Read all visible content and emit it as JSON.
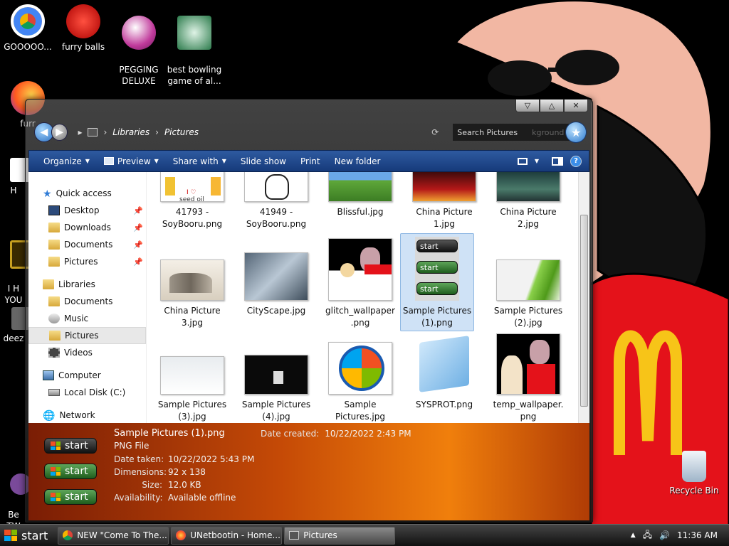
{
  "desktop": {
    "icons": [
      {
        "label": "GOOOOO..."
      },
      {
        "label": "furry balls"
      },
      {
        "label": "PEGGING\nDELUXE"
      },
      {
        "label": "best bowling\ngame of al..."
      },
      {
        "label": "furr"
      },
      {
        "label": "H"
      },
      {
        "label": "I H\nYOU"
      },
      {
        "label": "deez"
      },
      {
        "label": "Be\nTW"
      },
      {
        "label": "Recycle Bin"
      }
    ]
  },
  "window": {
    "caption_buttons": [
      "▽",
      "△",
      "✕"
    ],
    "breadcrumb": [
      "Libraries",
      "Pictures"
    ],
    "search_placeholder": "Search Pictures",
    "search_behind_text": "kground"
  },
  "toolbar": {
    "organize": "Organize",
    "preview": "Preview",
    "share_with": "Share with",
    "slide_show": "Slide show",
    "print": "Print",
    "new_folder": "New folder",
    "help": "?"
  },
  "nav": {
    "quick_access": "Quick access",
    "desktop": "Desktop",
    "downloads": "Downloads",
    "documents": "Documents",
    "pictures": "Pictures",
    "libraries": "Libraries",
    "lib_documents": "Documents",
    "lib_music": "Music",
    "lib_pictures": "Pictures",
    "lib_videos": "Videos",
    "computer": "Computer",
    "local_disk": "Local Disk (C:)",
    "network": "Network"
  },
  "files": [
    {
      "name": "41793 -\nSoyBooru.png"
    },
    {
      "name": "41949 -\nSoyBooru.png"
    },
    {
      "name": "Blissful.jpg"
    },
    {
      "name": "China Picture\n1.jpg"
    },
    {
      "name": "China Picture\n2.jpg"
    },
    {
      "name": "China Picture\n3.jpg"
    },
    {
      "name": "CityScape.jpg"
    },
    {
      "name": "glitch_wallpaper\n.png"
    },
    {
      "name": "Sample Pictures\n(1).png"
    },
    {
      "name": "Sample Pictures\n(2).jpg"
    },
    {
      "name": "Sample Pictures\n(3).jpg"
    },
    {
      "name": "Sample Pictures\n(4).jpg"
    },
    {
      "name": "Sample\nPictures.jpg"
    },
    {
      "name": "SYSPROT.png"
    },
    {
      "name": "temp_wallpaper.\npng"
    }
  ],
  "thumb_texts": {
    "start": "start",
    "seed_oil": "seed oil",
    "i_love": "I ♡"
  },
  "details": {
    "filename": "Sample Pictures (1).png",
    "type": "PNG File",
    "date_created_label": "Date created:",
    "date_created": "10/22/2022 2:43 PM",
    "date_taken_label": "Date taken:",
    "date_taken": "10/22/2022 5:43 PM",
    "dimensions_label": "Dimensions:",
    "dimensions": "92 x 138",
    "size_label": "Size:",
    "size": "12.0 KB",
    "availability_label": "Availability:",
    "availability": "Available offline",
    "start_label": "start"
  },
  "taskbar": {
    "start": "start",
    "tasks": [
      {
        "label": "NEW \"Come To The..."
      },
      {
        "label": "UNetbootin - Home..."
      },
      {
        "label": "Pictures"
      }
    ],
    "time": "11:36 AM"
  }
}
